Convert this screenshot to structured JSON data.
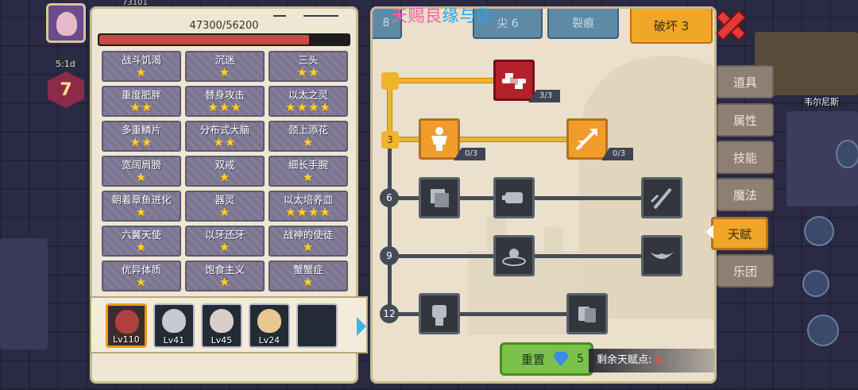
{
  "hud": {
    "top_number": "73101",
    "timer": "5:1d",
    "level": "7",
    "place_name": "韦尔尼斯"
  },
  "watermark": {
    "part_a": "天赐良",
    "part_b": "缘与你"
  },
  "stats": {
    "hp_text": "47300/56200",
    "hp_current": 47300,
    "hp_max": 56200
  },
  "traits": [
    {
      "name": "战斗饥渴",
      "stars": "★"
    },
    {
      "name": "沉迷",
      "stars": "★"
    },
    {
      "name": "三头",
      "stars": "★★"
    },
    {
      "name": "重度肥胖",
      "stars": "★★"
    },
    {
      "name": "替身攻击",
      "stars": "★★★"
    },
    {
      "name": "以太之灵",
      "stars": "★★★★"
    },
    {
      "name": "多重鳞片",
      "stars": "★★"
    },
    {
      "name": "分布式大脑",
      "stars": "★★"
    },
    {
      "name": "颈上添花",
      "stars": "★"
    },
    {
      "name": "宽阔肩膀",
      "stars": "★"
    },
    {
      "name": "双戒",
      "stars": "★"
    },
    {
      "name": "细长手腕",
      "stars": "★"
    },
    {
      "name": "朝着章鱼进化",
      "stars": "★"
    },
    {
      "name": "器灵",
      "stars": "★"
    },
    {
      "name": "以太培养皿",
      "stars": "★★★★"
    },
    {
      "name": "六翼天使",
      "stars": "★"
    },
    {
      "name": "以牙还牙",
      "stars": "★"
    },
    {
      "name": "战神的使徒",
      "stars": "★"
    },
    {
      "name": "优异体质",
      "stars": "★"
    },
    {
      "name": "饱食主义",
      "stars": "★"
    },
    {
      "name": "蟹蟹症",
      "stars": "★"
    }
  ],
  "heroes": [
    {
      "level": "Lv110",
      "active": true,
      "face": "#b04040"
    },
    {
      "level": "Lv41",
      "active": false,
      "face": "#c8c8d0"
    },
    {
      "level": "Lv45",
      "active": false,
      "face": "#d8d0c8"
    },
    {
      "level": "Lv24",
      "active": false,
      "face": "#e8c890"
    },
    {
      "level": "",
      "active": false,
      "face": ""
    }
  ],
  "tree": {
    "tabs": [
      {
        "label": "8",
        "active": false
      },
      {
        "label": "尖 6",
        "active": false
      },
      {
        "label": "裂痕",
        "active": false
      },
      {
        "label": "破坏 3",
        "active": true
      }
    ],
    "tiers": [
      "3",
      "6",
      "9",
      "12"
    ],
    "nodes": {
      "handshake": "3/3",
      "body": "0/3",
      "arrow": "0/3"
    },
    "reset_label": "重置",
    "gem_count": "5",
    "points_label": "剩余天赋点:",
    "points_value": "0"
  },
  "side_tabs": [
    "道具",
    "属性",
    "技能",
    "魔法",
    "天赋",
    "乐团"
  ],
  "active_side_tab": "天赋",
  "colors": {
    "accent": "#f0a629",
    "hp": "#c84a45",
    "reset_green": "#7cc24a",
    "close_red": "#e23a3a"
  }
}
